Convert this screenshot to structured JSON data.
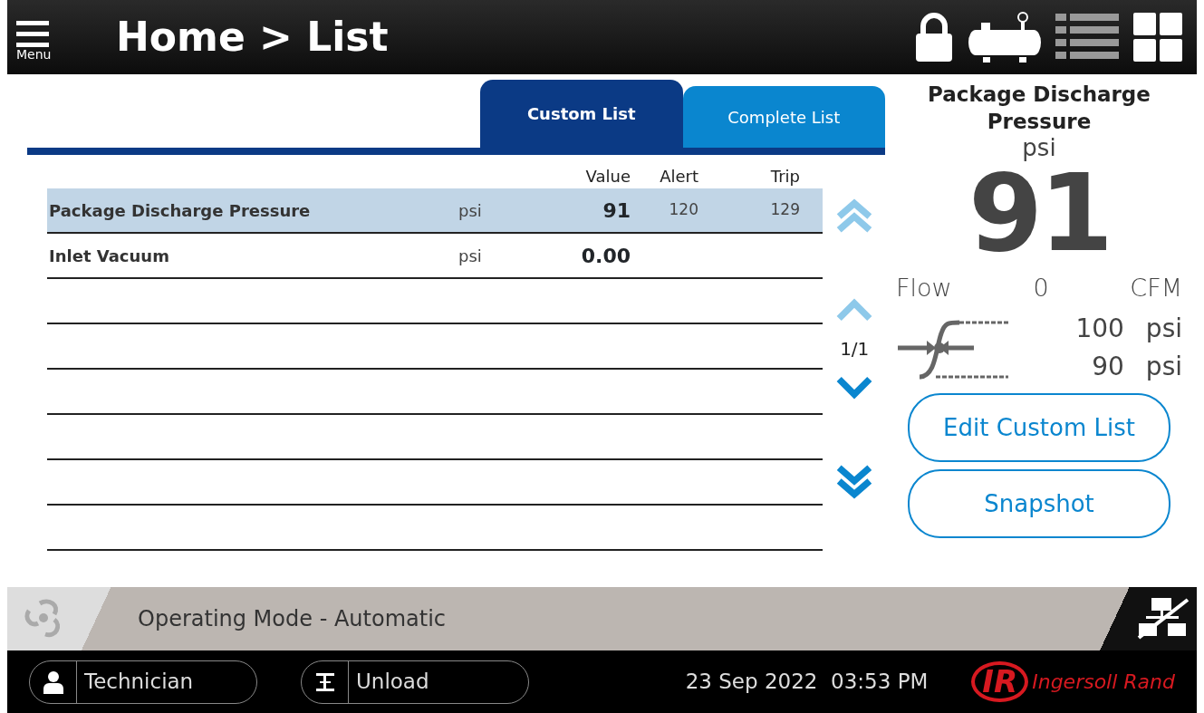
{
  "header": {
    "menu_label": "Menu",
    "title": "Home > List"
  },
  "tabs": [
    {
      "label": "Custom List",
      "selected": true
    },
    {
      "label": "Complete List",
      "selected": false
    }
  ],
  "table": {
    "columns": [
      "Value",
      "Alert",
      "Trip"
    ],
    "rows": [
      {
        "name": "Package Discharge Pressure",
        "unit": "psi",
        "value": "91",
        "alert": "120",
        "trip": "129",
        "selected": true
      },
      {
        "name": "Inlet Vacuum",
        "unit": "psi",
        "value": "0.00",
        "selected": false
      }
    ]
  },
  "pager": {
    "buttons": [
      {
        "kind": "first",
        "disabled": true
      },
      {
        "kind": "up",
        "disabled": true
      },
      {
        "kind": "down",
        "disabled": false
      },
      {
        "kind": "last",
        "disabled": false
      }
    ],
    "page": "1/1"
  },
  "detail": {
    "title": "Package Discharge Pressure",
    "unit": "psi",
    "value": "91",
    "flow": {
      "label": "Flow",
      "value": "0",
      "unit": "CFM"
    },
    "setpoints": [
      {
        "value": "100",
        "unit": "psi"
      },
      {
        "value": "90",
        "unit": "psi"
      }
    ],
    "buttons": [
      "Edit Custom List",
      "Snapshot"
    ]
  },
  "status_bar": {
    "text": "Operating Mode - Automatic"
  },
  "footer": {
    "user": "Technician",
    "mode": "Unload",
    "datetime": "23 Sep 2022  03:53 PM",
    "logo_mark": "IR",
    "logo_text": "Ingersoll Rand"
  }
}
